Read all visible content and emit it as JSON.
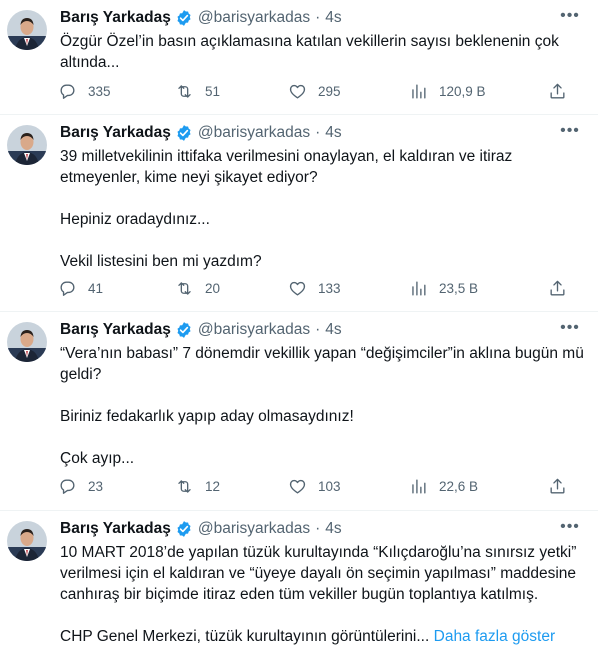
{
  "tweets": [
    {
      "name": "Barış Yarkadaş",
      "handle": "@barisyarkadas",
      "time": "4s",
      "paragraphs": [
        "Özgür Özel’in basın açıklamasına katılan vekillerin sayısı beklenenin çok altında..."
      ],
      "replies": "335",
      "retweets": "51",
      "likes": "295",
      "views": "120,9 B"
    },
    {
      "name": "Barış Yarkadaş",
      "handle": "@barisyarkadas",
      "time": "4s",
      "paragraphs": [
        "39 milletvekilinin ittifaka verilmesini onaylayan, el kaldıran ve itiraz etmeyenler, kime neyi şikayet ediyor?",
        "Hepiniz oradaydınız...",
        "Vekil listesini ben mi yazdım?"
      ],
      "replies": "41",
      "retweets": "20",
      "likes": "133",
      "views": "23,5 B"
    },
    {
      "name": "Barış Yarkadaş",
      "handle": "@barisyarkadas",
      "time": "4s",
      "paragraphs": [
        "“Vera’nın babası” 7 dönemdir vekillik yapan “değişimciler”in aklına bugün mü geldi?",
        "Biriniz fedakarlık yapıp aday olmasaydınız!",
        "Çok ayıp..."
      ],
      "replies": "23",
      "retweets": "12",
      "likes": "103",
      "views": "22,6 B"
    },
    {
      "name": "Barış Yarkadaş",
      "handle": "@barisyarkadas",
      "time": "4s",
      "paragraphs": [
        "10 MART 2018’de yapılan tüzük kurultayında “Kılıçdaroğlu’na sınırsız yetki” verilmesi için el kaldıran ve “üyeye dayalı ön seçimin yapılması” maddesine canhıraş bir biçimde itiraz eden tüm vekiller bugün toplantıya katılmış.",
        "CHP Genel Merkezi, tüzük kurultayının görüntülerini..."
      ],
      "show_more": "Daha fazla göster"
    }
  ],
  "icons": {
    "reply": "reply-icon",
    "retweet": "retweet-icon",
    "like": "heart-icon",
    "views": "views-icon",
    "share": "share-icon",
    "verified": "verified-badge-icon",
    "more": "more-icon"
  },
  "colors": {
    "text": "#0f1419",
    "secondary": "#536471",
    "link": "#1d9bf0",
    "verified": "#1d9bf0",
    "divider": "#eff3f4"
  }
}
